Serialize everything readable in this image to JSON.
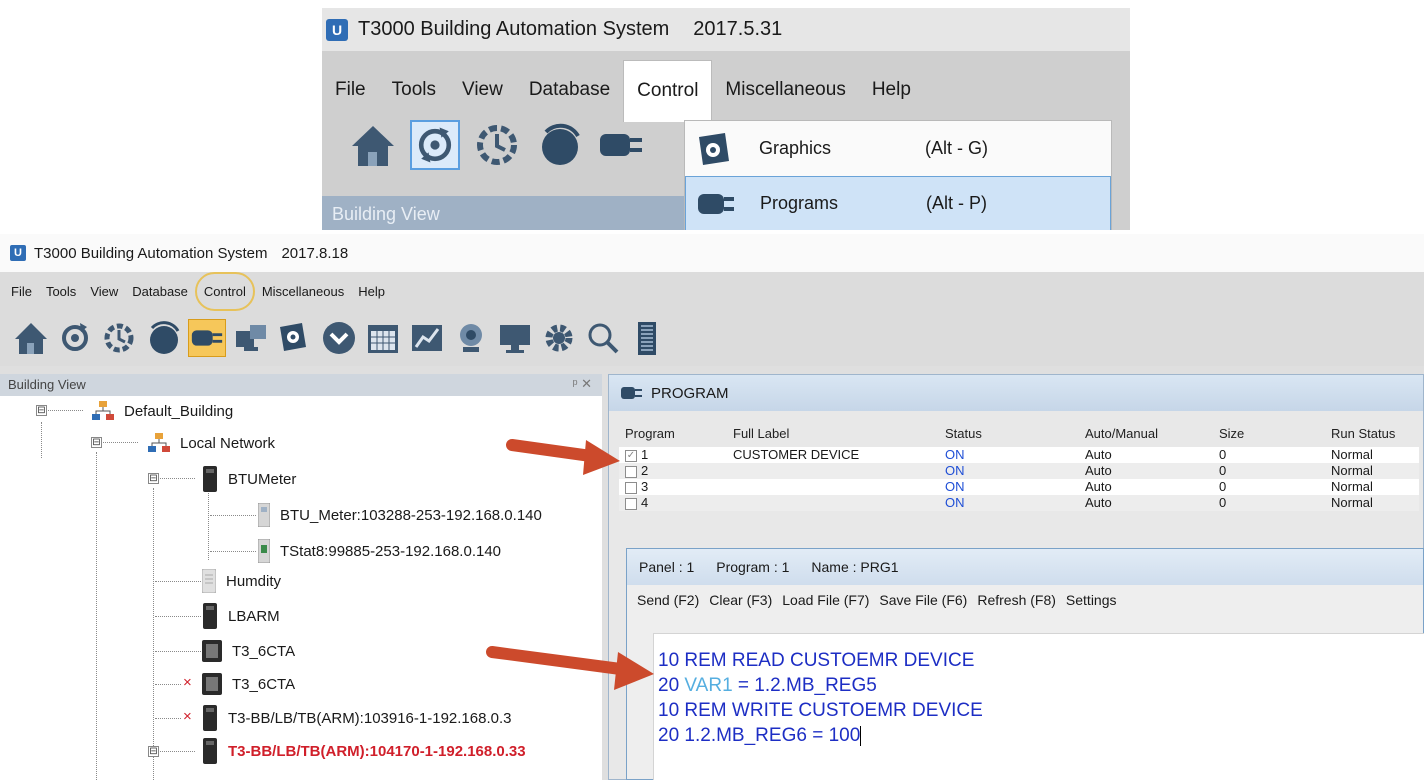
{
  "top": {
    "app_title": "T3000 Building Automation System",
    "version": "2017.5.31",
    "app_icon_text": "U",
    "menu": [
      "File",
      "Tools",
      "View",
      "Database",
      "Control",
      "Miscellaneous",
      "Help"
    ],
    "panel_label": "Building View",
    "dropdown": [
      {
        "label": "Graphics",
        "shortcut": "(Alt - G)"
      },
      {
        "label": "Programs",
        "shortcut": "(Alt - P)"
      }
    ]
  },
  "main": {
    "app_title": "T3000 Building Automation System",
    "version": "2017.8.18",
    "app_icon_text": "U",
    "menu": [
      "File",
      "Tools",
      "View",
      "Database",
      "Control",
      "Miscellaneous",
      "Help"
    ],
    "panel_label": "Building View",
    "panel_controls": "ᵖ ✕",
    "tree": [
      "Default_Building",
      "Local Network",
      "BTUMeter",
      "BTU_Meter:103288-253-192.168.0.140",
      "TStat8:99885-253-192.168.0.140",
      "Humdity",
      "LBARM",
      "T3_6CTA",
      "T3_6CTA",
      "T3-BB/LB/TB(ARM):103916-1-192.168.0.3",
      "T3-BB/LB/TB(ARM):104170-1-192.168.0.33"
    ],
    "expanders": [
      "⊟",
      "⊟",
      "⊟",
      "⊟"
    ],
    "error_mark": "×",
    "program_window": {
      "title": "PROGRAM",
      "columns": [
        "Program",
        "Full Label",
        "Status",
        "Auto/Manual",
        "Size",
        "Run Status"
      ],
      "rows": [
        {
          "num": "1",
          "label": "CUSTOMER DEVICE",
          "status": "ON",
          "mode": "Auto",
          "size": "0",
          "run": "Normal",
          "checked": "✓"
        },
        {
          "num": "2",
          "label": "",
          "status": "ON",
          "mode": "Auto",
          "size": "0",
          "run": "Normal",
          "checked": ""
        },
        {
          "num": "3",
          "label": "",
          "status": "ON",
          "mode": "Auto",
          "size": "0",
          "run": "Normal",
          "checked": ""
        },
        {
          "num": "4",
          "label": "",
          "status": "ON",
          "mode": "Auto",
          "size": "0",
          "run": "Normal",
          "checked": ""
        }
      ]
    },
    "editor": {
      "panel": "Panel : 1",
      "program": "Program : 1",
      "name": "Name : PRG1",
      "toolbar": [
        "Send (F2)",
        "Clear (F3)",
        "Load File (F7)",
        "Save File (F6)",
        "Refresh (F8)",
        "Settings"
      ],
      "code": {
        "l1": "10 REM READ CUSTOEMR DEVICE",
        "l2_pre": "20 ",
        "l2_var": "VAR1",
        "l2_post": " = 1.2.MB_REG5",
        "l3": "10 REM WRITE CUSTOEMR DEVICE",
        "l4": "20 1.2.MB_REG6 = 100"
      }
    }
  },
  "colors": {
    "accent": "#5a9ee0",
    "status_on": "#1f4fd6",
    "error_red": "#d01f2a",
    "arrow": "#cc4a2c",
    "highlight_circle": "#e7c25a"
  }
}
